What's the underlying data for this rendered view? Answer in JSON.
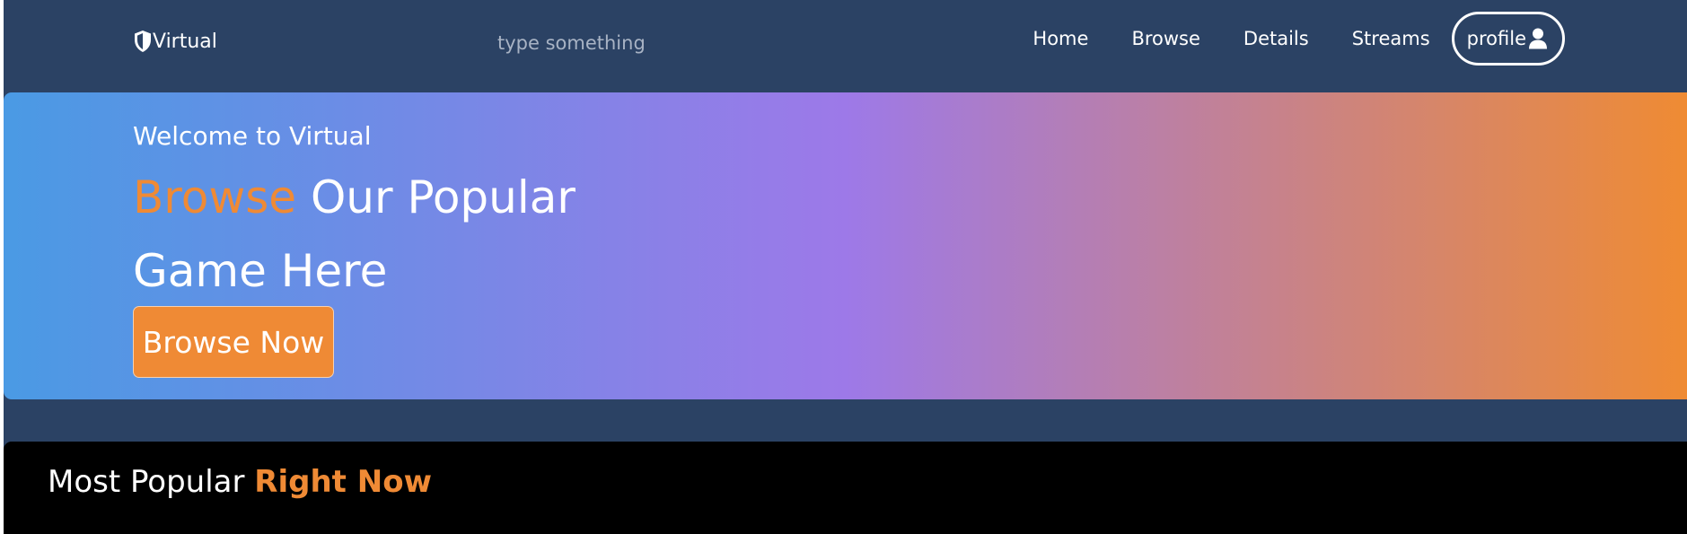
{
  "navbar": {
    "brand": "Virtual",
    "brand_icon": "shield-icon",
    "search": {
      "placeholder": "type something",
      "value": ""
    },
    "links": [
      "Home",
      "Browse",
      "Details",
      "Streams"
    ],
    "profile_label": "profile",
    "profile_icon": "user-icon"
  },
  "hero": {
    "welcome": "Welcome to Virtual",
    "headline_accent": "Browse",
    "headline_rest_1": " Our Popular",
    "headline_rest_2": "Game Here",
    "cta_label": "Browse Now"
  },
  "popular": {
    "title_main": "Most Popular ",
    "title_accent": "Right Now"
  },
  "colors": {
    "nav_background": "#2b4264",
    "accent_orange": "#ef8a35",
    "gradient_start": "#4a9ae4",
    "gradient_mid": "#9d79e8",
    "gradient_end": "#ef8b33",
    "section_background": "#000000"
  }
}
